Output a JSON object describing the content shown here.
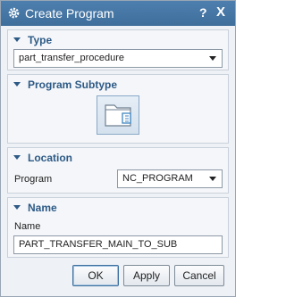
{
  "window": {
    "title": "Create Program",
    "help_label": "?",
    "close_label": "X",
    "icons": {
      "app": "gear-icon",
      "help": "help-icon",
      "close": "close-icon"
    }
  },
  "sections": {
    "type": {
      "header": "Type",
      "selected": "part_transfer_procedure"
    },
    "program_subtype": {
      "header": "Program Subtype",
      "icon": "program-folder-icon"
    },
    "location": {
      "header": "Location",
      "program_label": "Program",
      "program_value": "NC_PROGRAM"
    },
    "name": {
      "header": "Name",
      "name_label": "Name",
      "name_value": "PART_TRANSFER_MAIN_TO_SUB"
    }
  },
  "buttons": {
    "ok": "OK",
    "apply": "Apply",
    "cancel": "Cancel"
  },
  "colors": {
    "titlebar": "#4677a6",
    "section_header": "#2d5a86",
    "dialog_bg": "#eef1f5"
  }
}
